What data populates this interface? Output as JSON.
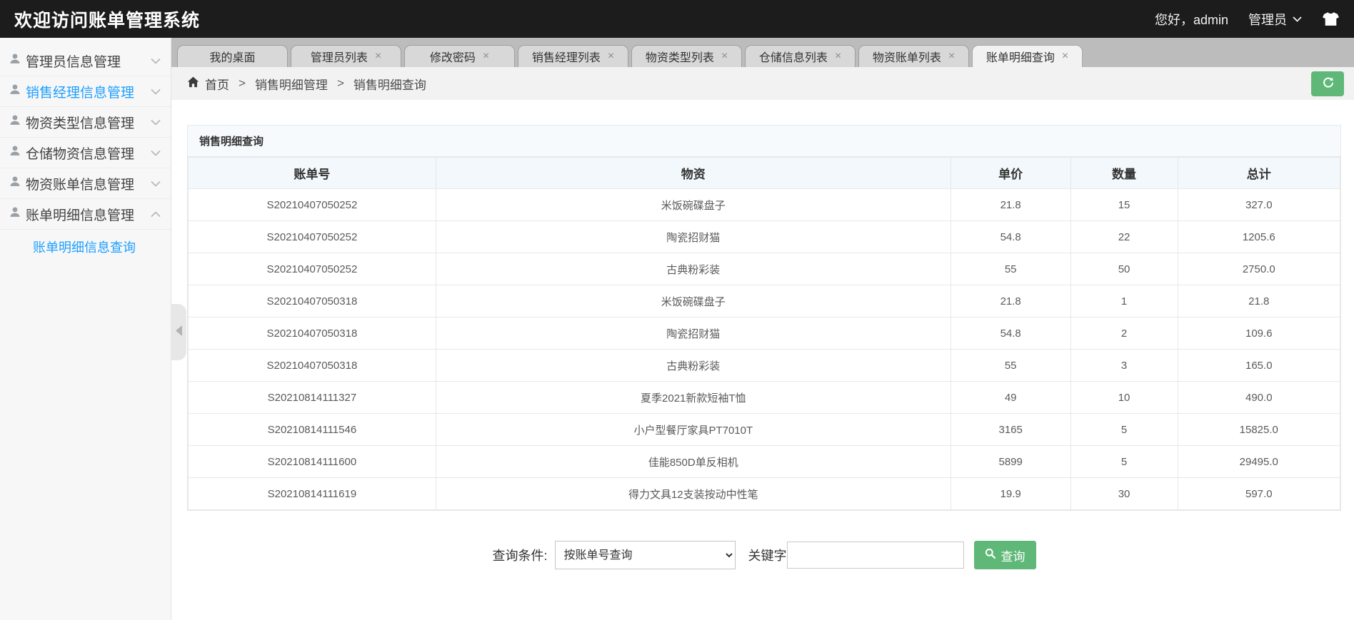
{
  "header": {
    "title": "欢迎访问账单管理系统",
    "greeting": "您好，admin",
    "role": "管理员"
  },
  "sidebar": {
    "items": [
      {
        "label": "管理员信息管理",
        "expanded": false,
        "active": false
      },
      {
        "label": "销售经理信息管理",
        "expanded": false,
        "active": true
      },
      {
        "label": "物资类型信息管理",
        "expanded": false,
        "active": false
      },
      {
        "label": "仓储物资信息管理",
        "expanded": false,
        "active": false
      },
      {
        "label": "物资账单信息管理",
        "expanded": false,
        "active": false
      },
      {
        "label": "账单明细信息管理",
        "expanded": true,
        "active": false
      }
    ],
    "submenu": {
      "label": "账单明细信息查询"
    }
  },
  "tabs": [
    {
      "label": "我的桌面",
      "closable": false,
      "active": false
    },
    {
      "label": "管理员列表",
      "closable": true,
      "active": false
    },
    {
      "label": "修改密码",
      "closable": true,
      "active": false
    },
    {
      "label": "销售经理列表",
      "closable": true,
      "active": false
    },
    {
      "label": "物资类型列表",
      "closable": true,
      "active": false
    },
    {
      "label": "仓储信息列表",
      "closable": true,
      "active": false
    },
    {
      "label": "物资账单列表",
      "closable": true,
      "active": false
    },
    {
      "label": "账单明细查询",
      "closable": true,
      "active": true
    }
  ],
  "tab_close_glyph": "×",
  "breadcrumb": {
    "home": "首页",
    "sep": ">",
    "section": "销售明细管理",
    "current": "销售明细查询"
  },
  "panel": {
    "title": "销售明细查询"
  },
  "table": {
    "columns": [
      "账单号",
      "物资",
      "单价",
      "数量",
      "总计"
    ],
    "rows": [
      [
        "S20210407050252",
        "米饭碗碟盘子",
        "21.8",
        "15",
        "327.0"
      ],
      [
        "S20210407050252",
        "陶瓷招财猫",
        "54.8",
        "22",
        "1205.6"
      ],
      [
        "S20210407050252",
        "古典粉彩装",
        "55",
        "50",
        "2750.0"
      ],
      [
        "S20210407050318",
        "米饭碗碟盘子",
        "21.8",
        "1",
        "21.8"
      ],
      [
        "S20210407050318",
        "陶瓷招财猫",
        "54.8",
        "2",
        "109.6"
      ],
      [
        "S20210407050318",
        "古典粉彩装",
        "55",
        "3",
        "165.0"
      ],
      [
        "S20210814111327",
        "夏季2021新款短袖T恤",
        "49",
        "10",
        "490.0"
      ],
      [
        "S20210814111546",
        "小户型餐厅家具PT7010T",
        "3165",
        "5",
        "15825.0"
      ],
      [
        "S20210814111600",
        "佳能850D单反相机",
        "5899",
        "5",
        "29495.0"
      ],
      [
        "S20210814111619",
        "得力文具12支装按动中性笔",
        "19.9",
        "30",
        "597.0"
      ]
    ]
  },
  "query": {
    "condition_label": "查询条件:",
    "select_value": "按账单号查询",
    "keyword_label": "关键字",
    "keyword_value": "",
    "search_label": "查询"
  },
  "icons": {
    "user": "person-silhouette",
    "chevron_down": "v-chevron",
    "chevron_up": "^-chevron",
    "home": "house",
    "refresh": "circular-arrow",
    "tshirt": "t-shirt",
    "search": "magnifier",
    "close": "×",
    "collapse": "left-triangle"
  },
  "colors": {
    "accent_blue": "#1e9fff",
    "green": "#5fb878",
    "header_bg": "#1c1c1c"
  }
}
